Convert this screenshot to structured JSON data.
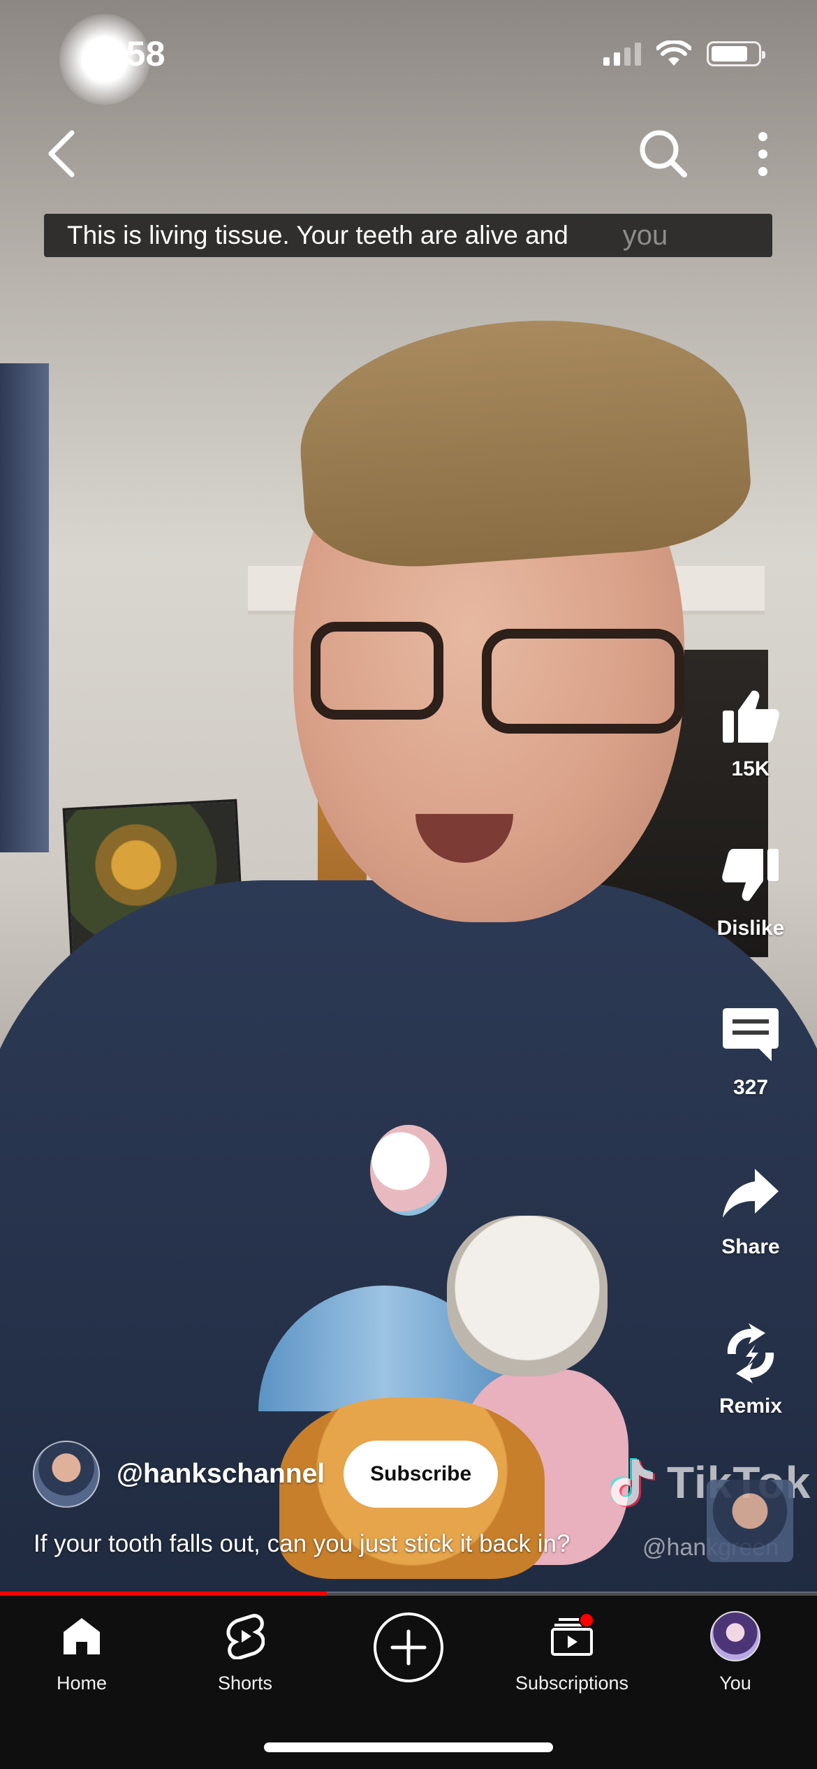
{
  "status_bar": {
    "time": "7:58"
  },
  "caption": {
    "text": "This is living tissue. Your teeth are alive and",
    "next_word": "you"
  },
  "actions": {
    "like_count": "15K",
    "dislike_label": "Dislike",
    "comment_count": "327",
    "share_label": "Share",
    "remix_label": "Remix"
  },
  "channel": {
    "handle": "@hankschannel",
    "subscribe_label": "Subscribe"
  },
  "video": {
    "title": "If your tooth falls out, can you just stick it back in?",
    "progress_fraction": 0.4,
    "watermark_brand": "TikTok",
    "watermark_handle": "@hankgreen"
  },
  "bottom_nav": {
    "items": [
      {
        "label": "Home",
        "icon": "home-icon"
      },
      {
        "label": "Shorts",
        "icon": "shorts-icon"
      },
      {
        "label": "",
        "icon": "create-plus-icon"
      },
      {
        "label": "Subscriptions",
        "icon": "subscriptions-icon"
      },
      {
        "label": "You",
        "icon": "avatar"
      }
    ]
  },
  "colors": {
    "accent_red": "#ff0000",
    "nav_bg": "#0f0f0f"
  }
}
